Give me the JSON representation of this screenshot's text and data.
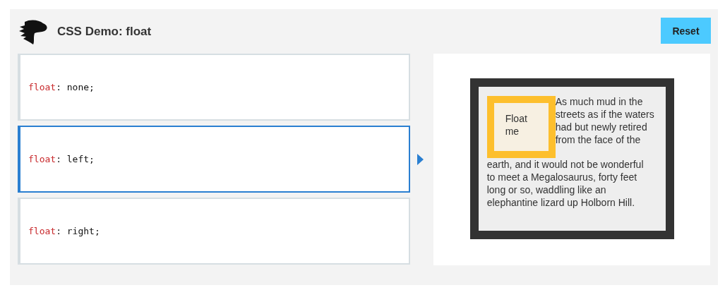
{
  "header": {
    "title": "CSS Demo: float",
    "reset_button": "Reset"
  },
  "choices": [
    {
      "property": "float",
      "rest": ": none;",
      "selected": false
    },
    {
      "property": "float",
      "rest": ": left;",
      "selected": true
    },
    {
      "property": "float",
      "rest": ": right;",
      "selected": false
    }
  ],
  "output": {
    "float_label": "Float me",
    "text_beside": "As much mud in the streets as if the waters had but newly retired from the face of the",
    "text_below": "earth, and it would not be wonderful to meet a Megalosaurus, forty feet long or so, waddling like an elephantine lizard up Holborn Hill."
  }
}
